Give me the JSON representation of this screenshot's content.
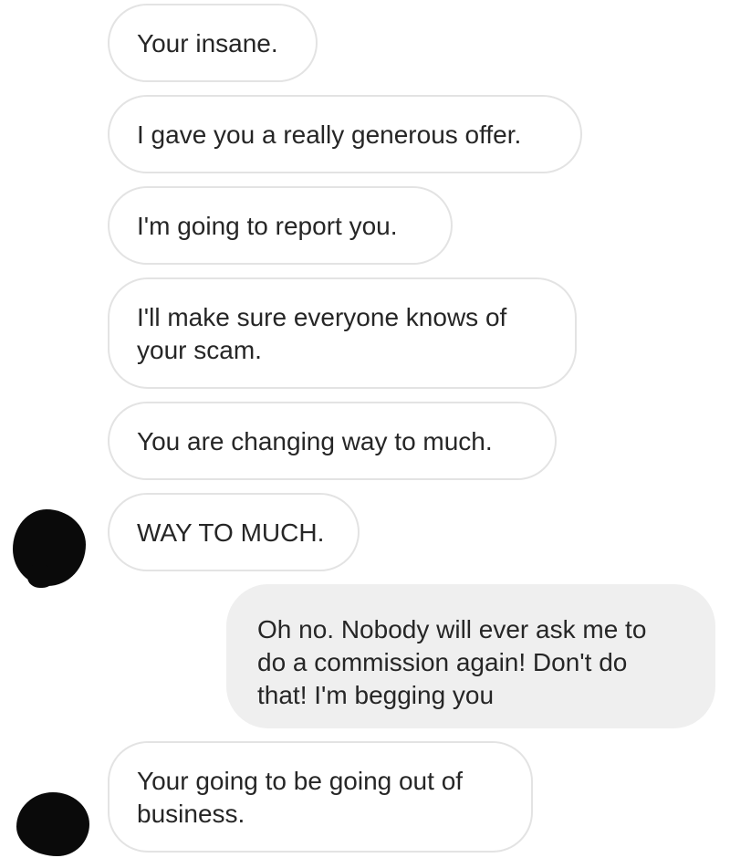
{
  "messages": [
    {
      "sender": "them",
      "text": "Your insane."
    },
    {
      "sender": "them",
      "text": "I gave you a really generous offer."
    },
    {
      "sender": "them",
      "text": "I'm going to report you."
    },
    {
      "sender": "them",
      "text": "I'll make sure everyone knows of your scam."
    },
    {
      "sender": "them",
      "text": "You are changing way to much."
    },
    {
      "sender": "them",
      "text": "WAY TO MUCH."
    },
    {
      "sender": "me",
      "text": "Oh no. Nobody will ever ask me to do a commission again! Don't do that! I'm begging you"
    },
    {
      "sender": "them",
      "text": "Your going to be going out of business."
    }
  ],
  "colors": {
    "incoming_bg": "#ffffff",
    "incoming_border": "#e3e3e3",
    "outgoing_bg": "#efefef",
    "text": "#262626",
    "avatar": "#0a0a0a"
  },
  "icons": {
    "avatar": "redacted-avatar-icon"
  }
}
